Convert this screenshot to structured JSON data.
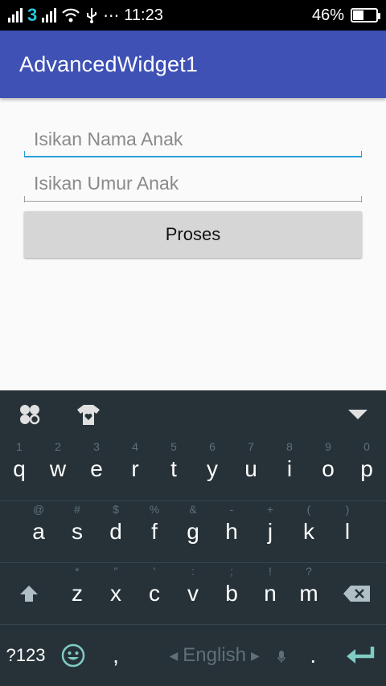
{
  "status_bar": {
    "carrier_badge": "3",
    "time": "11:23",
    "battery": "46%",
    "battery_level": 0.46
  },
  "app_bar": {
    "title": "AdvancedWidget1"
  },
  "form": {
    "name_placeholder": "Isikan Nama Anak",
    "age_placeholder": "Isikan Umur Anak",
    "submit_label": "Proses"
  },
  "keyboard": {
    "row1": [
      {
        "key": "q",
        "hint": "1"
      },
      {
        "key": "w",
        "hint": "2"
      },
      {
        "key": "e",
        "hint": "3"
      },
      {
        "key": "r",
        "hint": "4"
      },
      {
        "key": "t",
        "hint": "5"
      },
      {
        "key": "y",
        "hint": "6"
      },
      {
        "key": "u",
        "hint": "7"
      },
      {
        "key": "i",
        "hint": "8"
      },
      {
        "key": "o",
        "hint": "9"
      },
      {
        "key": "p",
        "hint": "0"
      }
    ],
    "row2": [
      {
        "key": "a",
        "hint": "@"
      },
      {
        "key": "s",
        "hint": "#"
      },
      {
        "key": "d",
        "hint": "$"
      },
      {
        "key": "f",
        "hint": "%"
      },
      {
        "key": "g",
        "hint": "&"
      },
      {
        "key": "h",
        "hint": "-"
      },
      {
        "key": "j",
        "hint": "+"
      },
      {
        "key": "k",
        "hint": "("
      },
      {
        "key": "l",
        "hint": ")"
      }
    ],
    "row3": [
      {
        "key": "z",
        "hint": "*"
      },
      {
        "key": "x",
        "hint": "\""
      },
      {
        "key": "c",
        "hint": "'"
      },
      {
        "key": "v",
        "hint": ":"
      },
      {
        "key": "b",
        "hint": ";"
      },
      {
        "key": "n",
        "hint": "!"
      },
      {
        "key": "m",
        "hint": "?"
      }
    ],
    "symbols_label": "?123",
    "comma": ",",
    "space_label": "English",
    "period": ".",
    "accent_color": "#80cbc4"
  }
}
